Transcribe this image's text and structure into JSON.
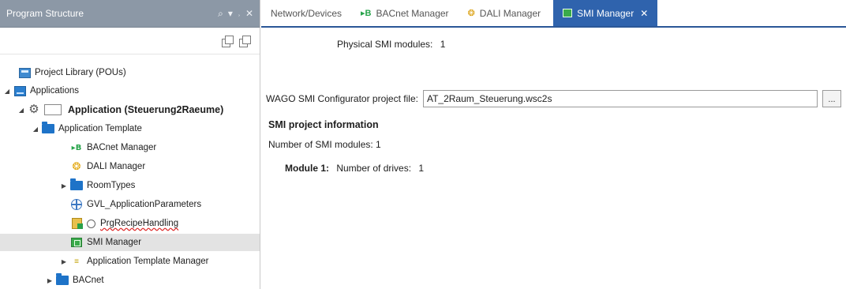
{
  "left_panel": {
    "title": "Program Structure",
    "header_icons": [
      "search-icon",
      "dropdown-arrow-icon",
      "pin-icon",
      "close-icon"
    ],
    "tree": [
      {
        "label": "Project Library (POUs)",
        "icon": "library-icon"
      },
      {
        "label": "Applications",
        "icon": "applications-icon"
      },
      {
        "label": "Application (Steuerung2Raeume)",
        "icon": "gear-icon"
      },
      {
        "label": "Application Template",
        "icon": "folder-icon"
      },
      {
        "label": "BACnet Manager",
        "icon": "bacnet-icon"
      },
      {
        "label": "DALI Manager",
        "icon": "dali-icon"
      },
      {
        "label": "RoomTypes",
        "icon": "folder-icon"
      },
      {
        "label": "GVL_ApplicationParameters",
        "icon": "gvl-icon"
      },
      {
        "label": "PrgRecipeHandling",
        "icon": "program-icon"
      },
      {
        "label": "SMI Manager",
        "icon": "smi-icon",
        "selected": true
      },
      {
        "label": "Application Template Manager",
        "icon": "template-manager-icon"
      },
      {
        "label": "BACnet",
        "icon": "folder-icon"
      }
    ]
  },
  "tabs": [
    {
      "label": "Network/Devices",
      "icon": ""
    },
    {
      "label": "BACnet Manager",
      "icon": "bacnet-icon"
    },
    {
      "label": "DALI Manager",
      "icon": "dali-icon"
    },
    {
      "label": "SMI Manager",
      "icon": "smi-icon",
      "active": true
    }
  ],
  "smi": {
    "physical_label": "Physical SMI modules:",
    "physical_value": "1",
    "project_file_label": "WAGO SMI Configurator project file:",
    "project_file_value": "AT_2Raum_Steuerung.wsc2s",
    "browse_label": "...",
    "info_title": "SMI project information",
    "module_count_text": "Number of SMI modules: 1",
    "module_label": "Module 1:",
    "drives_label": "Number of drives:",
    "drives_value": "1"
  },
  "colors": {
    "panel_header_bg": "#8c98a6",
    "active_tab_bg": "#2f63ad",
    "folder_blue": "#1e73c8",
    "smi_green": "#3aaa4a"
  }
}
